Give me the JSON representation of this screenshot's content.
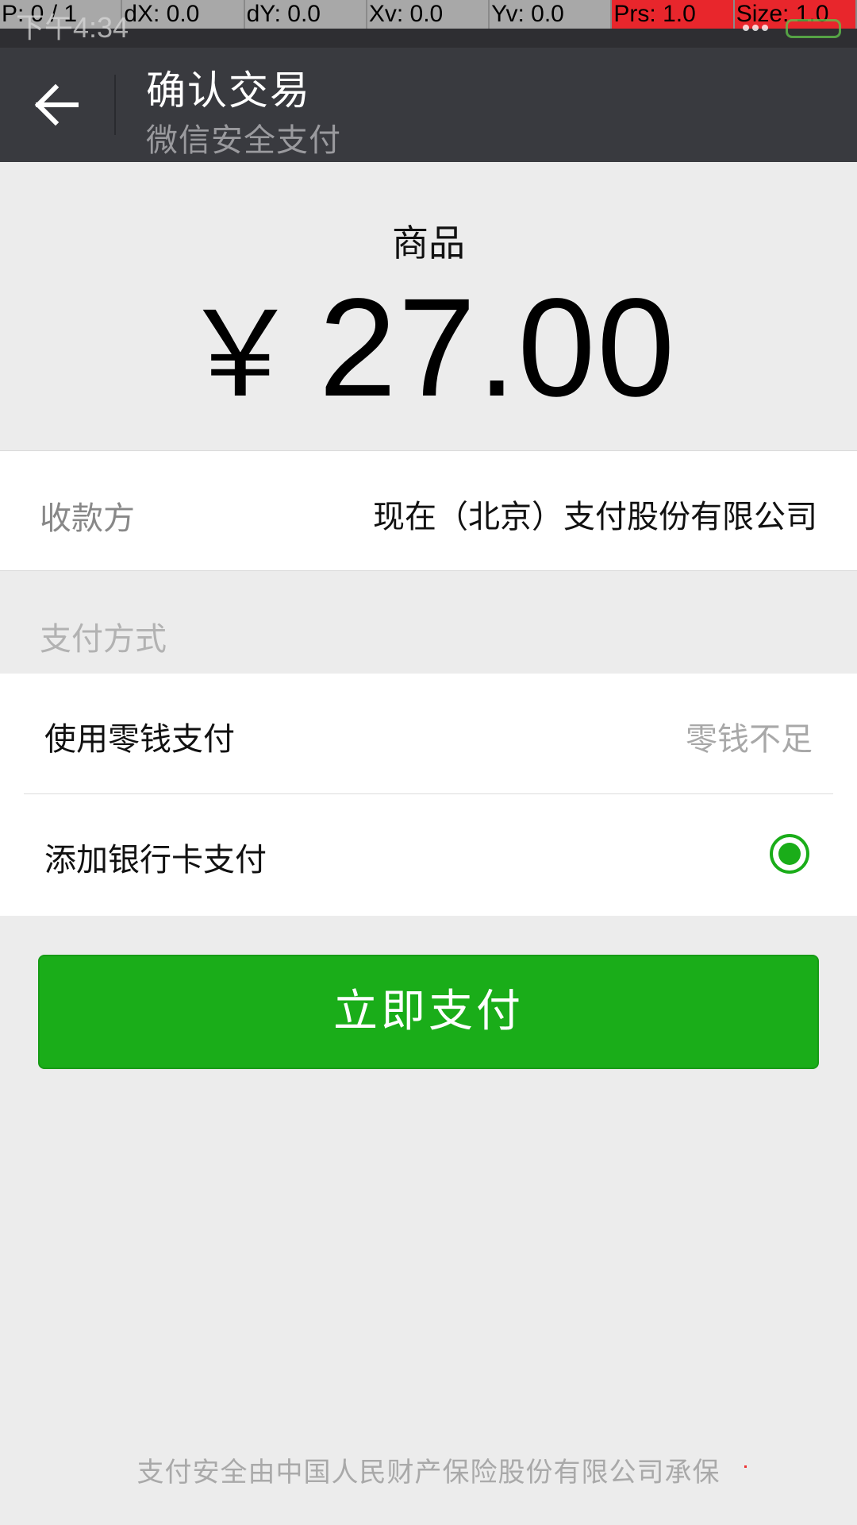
{
  "debug_overlay": {
    "pointer": "P: 0 / 1",
    "dx": "dX: 0.0",
    "dy": "dY: 0.0",
    "xv": "Xv: 0.0",
    "yv": "Yv: 0.0",
    "prs": "Prs: 1.0",
    "size": "Size: 1.0"
  },
  "status_bar": {
    "time": "下午4:34"
  },
  "header": {
    "title": "确认交易",
    "subtitle": "微信安全支付",
    "back_icon": "arrow-left-icon"
  },
  "order": {
    "product_label": "商品",
    "currency_symbol": "￥",
    "amount": "27.00"
  },
  "payee": {
    "label": "收款方",
    "value": "现在（北京）支付股份有限公司"
  },
  "payment_method": {
    "header": "支付方式",
    "options": [
      {
        "label": "使用零钱支付",
        "status": "零钱不足",
        "selected": false
      },
      {
        "label": "添加银行卡支付",
        "status": "",
        "selected": true
      }
    ]
  },
  "actions": {
    "pay_label": "立即支付"
  },
  "footer": {
    "text": "支付安全由中国人民财产保险股份有限公司承保"
  },
  "colors": {
    "brand_green": "#1aad19",
    "header_bg": "#393a3f",
    "page_bg": "#ececec"
  }
}
